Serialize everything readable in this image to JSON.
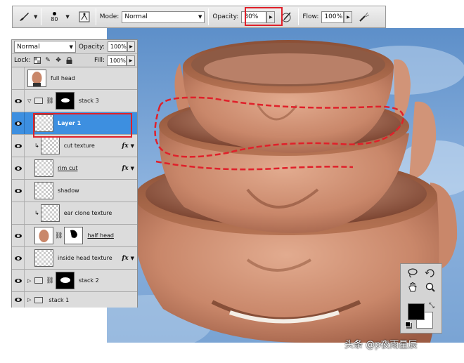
{
  "options_bar": {
    "brush_size": "80",
    "mode_label": "Mode:",
    "mode_value": "Normal",
    "opacity_label": "Opacity:",
    "opacity_value": "30%",
    "flow_label": "Flow:",
    "flow_value": "100%"
  },
  "layers": {
    "blend_mode": "Normal",
    "opacity_label": "Opacity:",
    "opacity_value": "100%",
    "lock_label": "Lock:",
    "fill_label": "Fill:",
    "fill_value": "100%",
    "rows": [
      {
        "name": "full head"
      },
      {
        "name": "stack 3"
      },
      {
        "name": "Layer 1"
      },
      {
        "name": "cut texture"
      },
      {
        "name": "rim cut"
      },
      {
        "name": "shadow"
      },
      {
        "name": "ear clone texture"
      },
      {
        "name": "half head"
      },
      {
        "name": "inside head texture"
      },
      {
        "name": "stack 2"
      },
      {
        "name": "stack 1"
      }
    ],
    "fx_label": "fx"
  },
  "watermark": "头条 @p夜雨星辰",
  "colors": {
    "highlight": "#e0202a",
    "selection": "#3d8fe0",
    "sky": "#6f9fd3",
    "foreground": "#000000",
    "background": "#ffffff"
  }
}
